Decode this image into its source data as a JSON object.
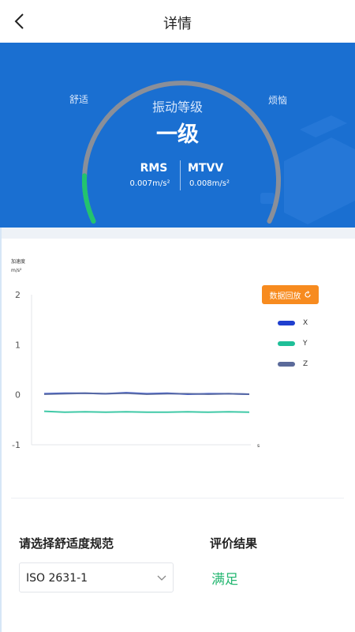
{
  "header": {
    "title": "详情"
  },
  "hero": {
    "label_left": "舒适",
    "label_right": "烦恼",
    "level_title": "振动等级",
    "level_value": "一级",
    "rms": {
      "name": "RMS",
      "value": "0.007m/s²"
    },
    "mtvv": {
      "name": "MTVV",
      "value": "0.008m/s²"
    },
    "gauge_level": 0.12,
    "colors": {
      "background": "#1a6fd1",
      "gauge_track": "#8a8f99",
      "gauge_fill": "#22c46e"
    }
  },
  "chart_data": {
    "type": "line",
    "ylabel": "加速度",
    "yunit": "m/s²",
    "xunit": "s",
    "ylim": [
      -1,
      2
    ],
    "yticks": [
      "2",
      "1",
      "0",
      "-1"
    ],
    "series": [
      {
        "name": "X",
        "color": "#1f3fcf",
        "values": [
          0.02,
          0.03,
          0.03,
          0.02,
          0.04,
          0.02,
          0.03,
          0.01,
          0.02,
          0.02,
          0.01
        ]
      },
      {
        "name": "Y",
        "color": "#1fbf98",
        "values": [
          -0.33,
          -0.35,
          -0.34,
          -0.35,
          -0.34,
          -0.35,
          -0.35,
          -0.34,
          -0.35,
          -0.34,
          -0.35
        ]
      },
      {
        "name": "Z",
        "color": "#5b6a9a",
        "values": [
          0.01,
          0.02,
          0.03,
          0.02,
          0.03,
          0.01,
          0.02,
          0.02,
          0.01,
          0.02,
          0.01
        ]
      }
    ]
  },
  "replay": {
    "label": "数据回放"
  },
  "standard": {
    "label": "请选择舒适度规范",
    "selected": "ISO 2631-1"
  },
  "result": {
    "label": "评价结果",
    "value": "满足",
    "color": "#26b772"
  }
}
